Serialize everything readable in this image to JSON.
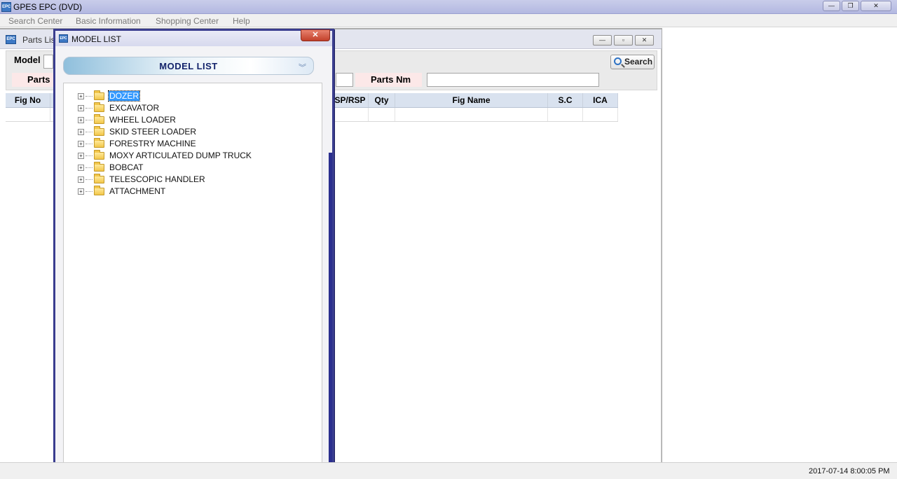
{
  "app": {
    "title": "GPES EPC (DVD)",
    "logo": "EPC",
    "minimize": "—",
    "restore": "❐",
    "close": "✕"
  },
  "menu": [
    {
      "label": "Search Center"
    },
    {
      "label": "Basic Information"
    },
    {
      "label": "Shopping Center"
    },
    {
      "label": "Help"
    }
  ],
  "parts_window": {
    "title": "Parts List",
    "logo": "EPC",
    "btn_min": "—",
    "btn_max": "▫",
    "btn_close": "✕",
    "model_label": "Model",
    "model_value": "",
    "parts_label": "Parts",
    "parts_value": "",
    "parts_nm_label": "Parts Nm",
    "parts_nm_value": "",
    "search_button": "Search",
    "columns": [
      "Fig No",
      "",
      "SP/RSP",
      "Qty",
      "Fig Name",
      "S.C",
      "ICA"
    ]
  },
  "model_list_dialog": {
    "title": "MODEL LIST",
    "logo": "EPC",
    "close": "✕",
    "header": "MODEL LIST",
    "header_icon": "chevron-down-double",
    "tree": [
      {
        "label": "DOZER",
        "selected": true
      },
      {
        "label": "EXCAVATOR"
      },
      {
        "label": "WHEEL LOADER"
      },
      {
        "label": "SKID STEER LOADER"
      },
      {
        "label": "FORESTRY MACHINE"
      },
      {
        "label": "MOXY ARTICULATED DUMP TRUCK"
      },
      {
        "label": "BOBCAT"
      },
      {
        "label": "TELESCOPIC HANDLER"
      },
      {
        "label": "ATTACHMENT"
      }
    ]
  },
  "status": {
    "datetime": "2017-07-14 8:00:05 PM"
  }
}
